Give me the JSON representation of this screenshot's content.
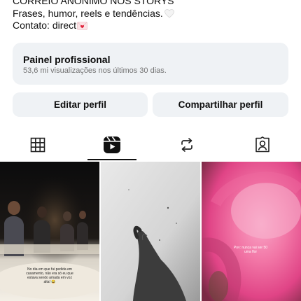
{
  "bio": {
    "line1": "CORREIO ANÔNIMO NOS STORYS",
    "line2": "Frases, humor, reels e tendências.",
    "line3": "Contato: direct"
  },
  "professional_panel": {
    "title": "Painel profissional",
    "subtitle": "53,6 mi visualizações nos últimos 30 dias."
  },
  "buttons": {
    "edit_profile": "Editar perfil",
    "share_profile": "Compartilhar perfil"
  },
  "tabs": [
    {
      "icon": "grid-icon",
      "active": false
    },
    {
      "icon": "reels-icon",
      "active": true
    },
    {
      "icon": "reposts-icon",
      "active": false
    },
    {
      "icon": "tagged-icon",
      "active": false
    }
  ],
  "reels": [
    {
      "caption": "No dia em que fui pedida em casamento, não era só eu que estava sendo amada em voz alta! 😂"
    },
    {
      "caption": ""
    },
    {
      "caption": "Pov: nunca vai ser 50 uma flor"
    }
  ]
}
